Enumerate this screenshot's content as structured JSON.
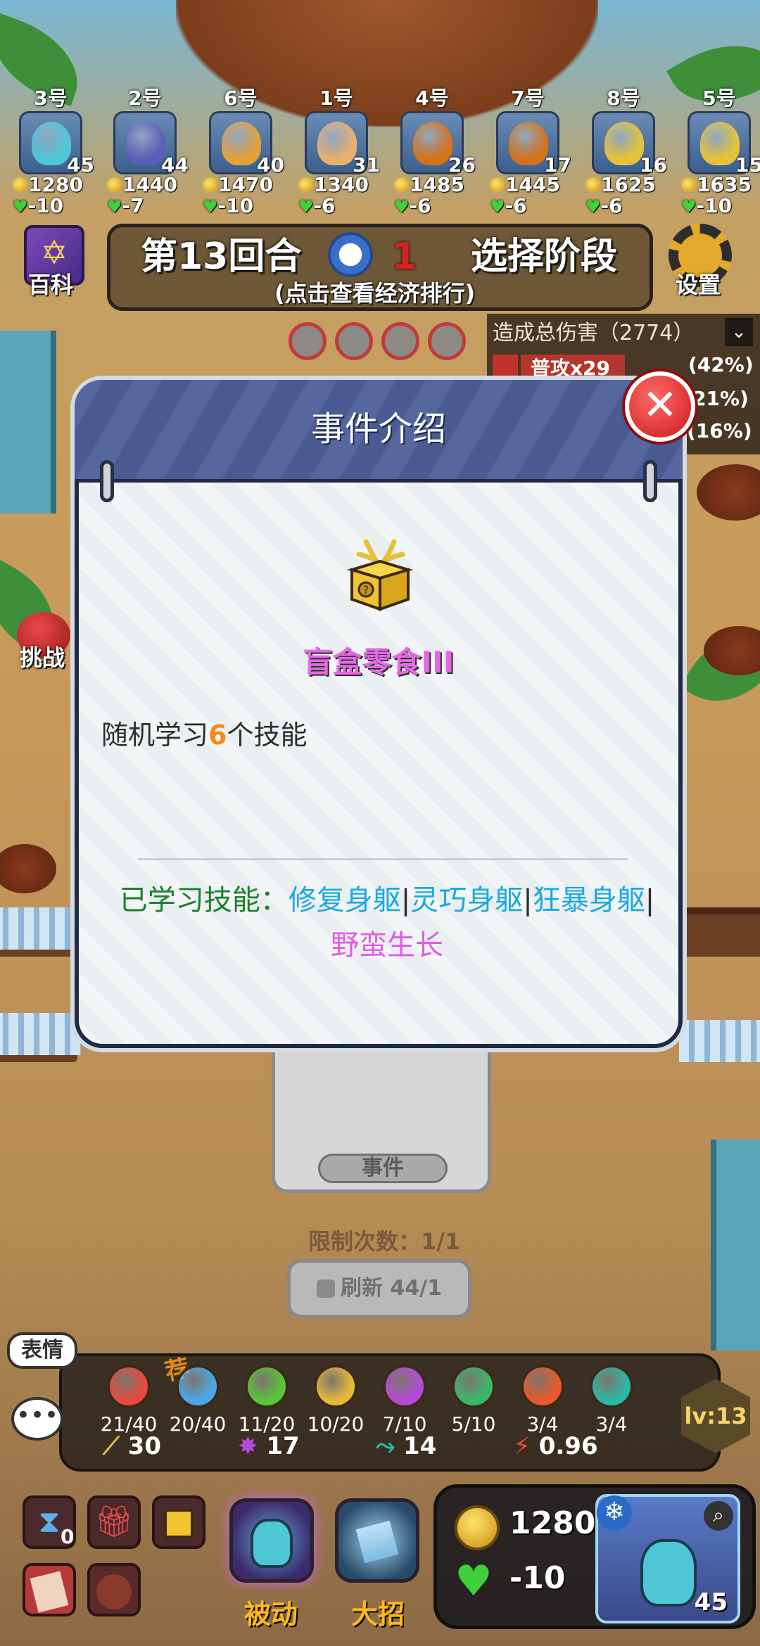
{
  "players": [
    {
      "rank": "3号",
      "level": "45",
      "gold": "1280",
      "hp": "-10",
      "color": "#4fc6d6"
    },
    {
      "rank": "2号",
      "level": "44",
      "gold": "1440",
      "hp": "-7",
      "color": "#5c5fb8"
    },
    {
      "rank": "6号",
      "level": "40",
      "gold": "1470",
      "hp": "-10",
      "color": "#e3a13a"
    },
    {
      "rank": "1号",
      "level": "31",
      "gold": "1340",
      "hp": "-6",
      "color": "#e8b070"
    },
    {
      "rank": "4号",
      "level": "26",
      "gold": "1485",
      "hp": "-6",
      "color": "#d4731a"
    },
    {
      "rank": "7号",
      "level": "17",
      "gold": "1445",
      "hp": "-6",
      "color": "#d4731a"
    },
    {
      "rank": "8号",
      "level": "16",
      "gold": "1625",
      "hp": "-6",
      "color": "#e6c23a"
    },
    {
      "rank": "5号",
      "level": "15",
      "gold": "1635",
      "hp": "-10",
      "color": "#e6c23a"
    }
  ],
  "header": {
    "encyclopedia_label": "百科",
    "round_label": "第13回合",
    "timer_value": "1",
    "phase_label": "选择阶段",
    "economy_hint": "(点击查看经济排行)",
    "settings_label": "设置",
    "challenge_label": "挑战"
  },
  "damage_panel": {
    "title": "造成总伤害（2774）",
    "rows": [
      {
        "label": "普攻x29",
        "pct": "(42%)"
      },
      {
        "label": "",
        "pct": "21%)"
      },
      {
        "label": "",
        "pct": "(16%)"
      }
    ]
  },
  "modal": {
    "title": "事件介绍",
    "item_name": "盲盒零食III",
    "desc_prefix": "随机学习",
    "desc_number": "6",
    "desc_suffix": "个技能",
    "learned_label": "已学习技能：",
    "skills": [
      "修复身躯",
      "灵巧身躯",
      "狂暴身躯"
    ],
    "last_skill": "野蛮生长",
    "separator": "|"
  },
  "event": {
    "tag": "事件",
    "limit": "限制次数：1/1",
    "refresh": "刷新 44/1"
  },
  "skillbar": {
    "recommend": "荐",
    "skills": [
      {
        "icon": "heart-icon",
        "count": "21/40",
        "color": "#e84a3a"
      },
      {
        "icon": "snowflake-icon",
        "count": "20/40",
        "color": "#4aa8e8"
      },
      {
        "icon": "plus-icon",
        "count": "11/20",
        "color": "#5ac43a"
      },
      {
        "icon": "sword-icon",
        "count": "10/20",
        "color": "#e6b83a"
      },
      {
        "icon": "burst-icon",
        "count": "7/10",
        "color": "#b44ad8"
      },
      {
        "icon": "paw-icon",
        "count": "5/10",
        "color": "#3ab86a"
      },
      {
        "icon": "flame-icon",
        "count": "3/4",
        "color": "#e85a2a"
      },
      {
        "icon": "wing-icon",
        "count": "3/4",
        "color": "#2ab8a8"
      }
    ],
    "attack": "30",
    "burst": "17",
    "speed": "14",
    "crit": "0.96",
    "level": "lv:13"
  },
  "chat": {
    "emote_label": "表情"
  },
  "bottom": {
    "slot_count": "0",
    "passive_label": "被动",
    "ultimate_label": "大招",
    "gold": "1280",
    "hp": "-10",
    "hero_level": "45"
  }
}
